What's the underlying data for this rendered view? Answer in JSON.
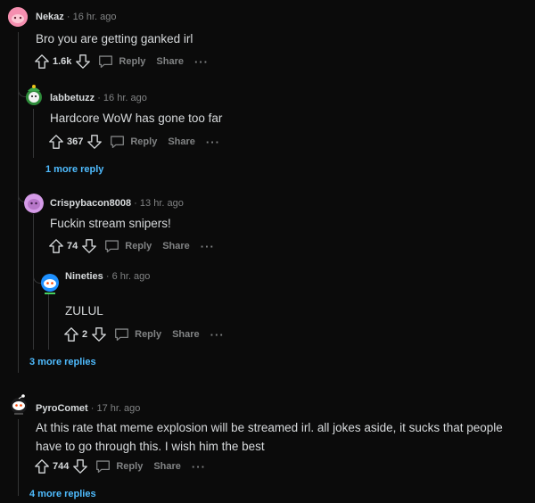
{
  "comments": [
    {
      "user": "Nekaz",
      "sep": "·",
      "time": "16 hr. ago",
      "text": "Bro you are getting ganked irl",
      "votes": "1.6k",
      "reply": "Reply",
      "share": "Share",
      "more": "···"
    },
    {
      "user": "labbetuzz",
      "sep": "·",
      "time": "16 hr. ago",
      "text": "Hardcore WoW has gone too far",
      "votes": "367",
      "reply": "Reply",
      "share": "Share",
      "more": "···"
    },
    {
      "user": "Crispybacon8008",
      "sep": "·",
      "time": "13 hr. ago",
      "text": "Fuckin stream snipers!",
      "votes": "74",
      "reply": "Reply",
      "share": "Share",
      "more": "···"
    },
    {
      "user": "Nineties",
      "sep": "·",
      "time": "6 hr. ago",
      "text": "ZULUL",
      "votes": "2",
      "reply": "Reply",
      "share": "Share",
      "more": "···"
    },
    {
      "user": "PyroComet",
      "sep": "·",
      "time": "17 hr. ago",
      "text": "At this rate that meme explosion will be streamed irl. all jokes aside, it sucks that people have to go through this. I wish him the best",
      "votes": "744",
      "reply": "Reply",
      "share": "Share",
      "more": "···"
    }
  ],
  "more_replies": {
    "labbetuzz": "1 more reply",
    "nekaz": "3 more replies",
    "pyrocomet": "4 more replies"
  },
  "colors": {
    "background": "#0b0b0b",
    "text": "#d7dadc",
    "muted": "#818384",
    "link": "#4fbcff",
    "thread_line": "#343536"
  },
  "icons": [
    "upvote-icon",
    "downvote-icon",
    "reply-bubble-icon",
    "overflow-dots-icon"
  ]
}
